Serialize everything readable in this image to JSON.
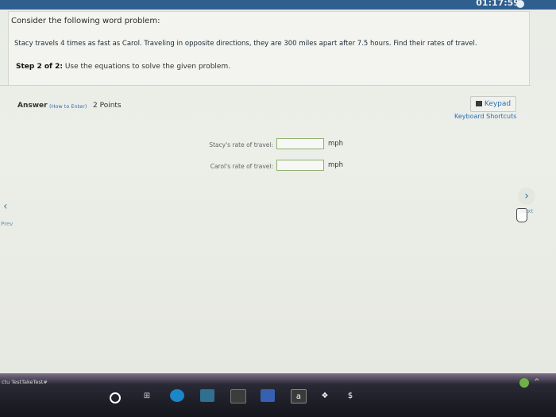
{
  "timer": "01:17:59",
  "problem": {
    "intro": "Consider the following word problem:",
    "statement": "Stacy travels 4 times as fast as Carol. Traveling in opposite directions, they are 300 miles apart after 7.5 hours. Find their rates of travel.",
    "step_label": "Step 2 of 2:",
    "step_text": " Use the equations to solve the given problem."
  },
  "answer": {
    "label": "Answer",
    "how_to_enter": "(How to Enter)",
    "points": "2 Points"
  },
  "tools": {
    "keypad": "Keypad",
    "shortcuts": "Keyboard Shortcuts"
  },
  "fields": [
    {
      "label": "Stacy's rate of travel:",
      "value": "",
      "unit": "mph"
    },
    {
      "label": "Carol's rate of travel:",
      "value": "",
      "unit": "mph"
    }
  ],
  "nav": {
    "prev": "Prev",
    "next": "Next"
  },
  "taskbar": {
    "window_label": "ctu TestTakeTest#"
  },
  "icons": {
    "prev": "chevron-left-icon",
    "next": "chevron-right-icon",
    "keypad": "keypad-icon"
  },
  "colors": {
    "accent": "#2f6fb0",
    "topbar": "#2f5f8f",
    "input_border": "#8fb06f"
  }
}
